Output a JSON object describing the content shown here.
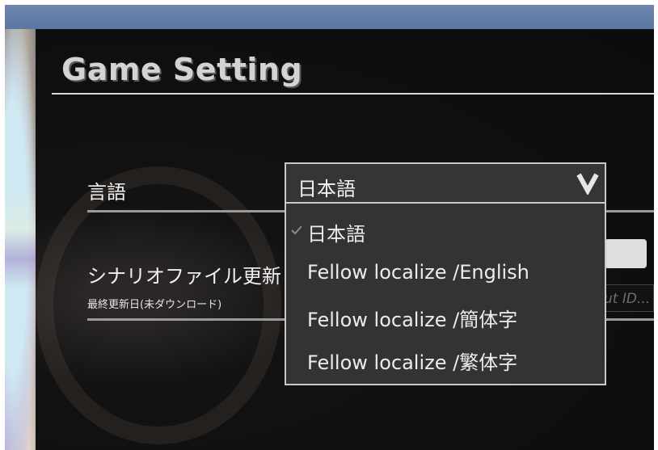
{
  "screen": {
    "title": "Game Setting"
  },
  "language": {
    "label": "言語",
    "selected": "日本語",
    "options": [
      {
        "label": "日本語",
        "checked": true
      },
      {
        "label": "Fellow localize /English",
        "checked": false
      },
      {
        "label": "Fellow localize /簡体字",
        "checked": false
      },
      {
        "label": "Fellow localize /繁体字",
        "checked": false
      }
    ]
  },
  "scenario": {
    "label": "シナリオファイル更新",
    "last_updated": "最終更新日(未ダウンロード)",
    "input_placeholder": "ut ID..."
  },
  "icons": {
    "dropdown": "chevron-down-icon",
    "selected": "check-icon"
  },
  "colors": {
    "panel_bg": "#121212",
    "top_bar": "#6a80a8",
    "text": "#f0f0f0",
    "dropdown_bg": "#333333"
  }
}
